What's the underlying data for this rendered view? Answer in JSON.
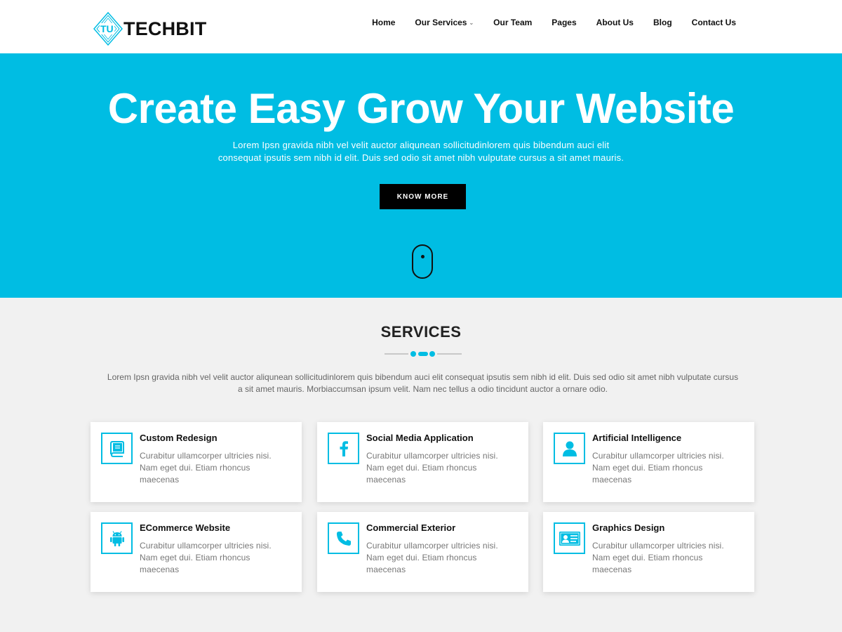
{
  "brand": {
    "logo_mark_text": "TU",
    "name": "TECHBIT",
    "accent_color": "#00bde3"
  },
  "nav": {
    "items": [
      {
        "label": "Home"
      },
      {
        "label": "Our Services",
        "has_dropdown": true
      },
      {
        "label": "Our Team"
      },
      {
        "label": "Pages"
      },
      {
        "label": "About Us"
      },
      {
        "label": "Blog"
      },
      {
        "label": "Contact Us"
      }
    ]
  },
  "hero": {
    "title": "Create Easy Grow Your Website",
    "subtitle_line1": "Lorem Ipsn gravida nibh vel velit auctor aliqunean sollicitudinlorem quis bibendum auci elit",
    "subtitle_line2": "consequat ipsutis sem nibh id elit. Duis sed odio sit amet nibh vulputate cursus a sit amet mauris.",
    "button_label": "KNOW MORE",
    "scroll_icon": "mouse-scroll-icon"
  },
  "services": {
    "title": "SERVICES",
    "description": "Lorem Ipsn gravida nibh vel velit auctor aliqunean sollicitudinlorem quis bibendum auci elit consequat ipsutis sem nibh id elit. Duis sed odio sit amet nibh vulputate cursus a sit amet mauris. Morbiaccumsan ipsum velit. Nam nec tellus a odio tincidunt auctor a ornare odio.",
    "cards": [
      {
        "title": "Custom Redesign",
        "text": "Curabitur ullamcorper ultricies nisi. Nam eget dui. Etiam rhoncus maecenas",
        "icon": "book-icon"
      },
      {
        "title": "Social Media Application",
        "text": "Curabitur ullamcorper ultricies nisi. Nam eget dui. Etiam rhoncus maecenas",
        "icon": "facebook-icon"
      },
      {
        "title": "Artificial Intelligence",
        "text": "Curabitur ullamcorper ultricies nisi. Nam eget dui. Etiam rhoncus maecenas",
        "icon": "user-icon"
      },
      {
        "title": "ECommerce Website",
        "text": "Curabitur ullamcorper ultricies nisi. Nam eget dui. Etiam rhoncus maecenas",
        "icon": "android-icon"
      },
      {
        "title": "Commercial Exterior",
        "text": "Curabitur ullamcorper ultricies nisi. Nam eget dui. Etiam rhoncus maecenas",
        "icon": "phone-icon"
      },
      {
        "title": "Graphics Design",
        "text": "Curabitur ullamcorper ultricies nisi. Nam eget dui. Etiam rhoncus maecenas",
        "icon": "id-card-icon"
      }
    ]
  }
}
